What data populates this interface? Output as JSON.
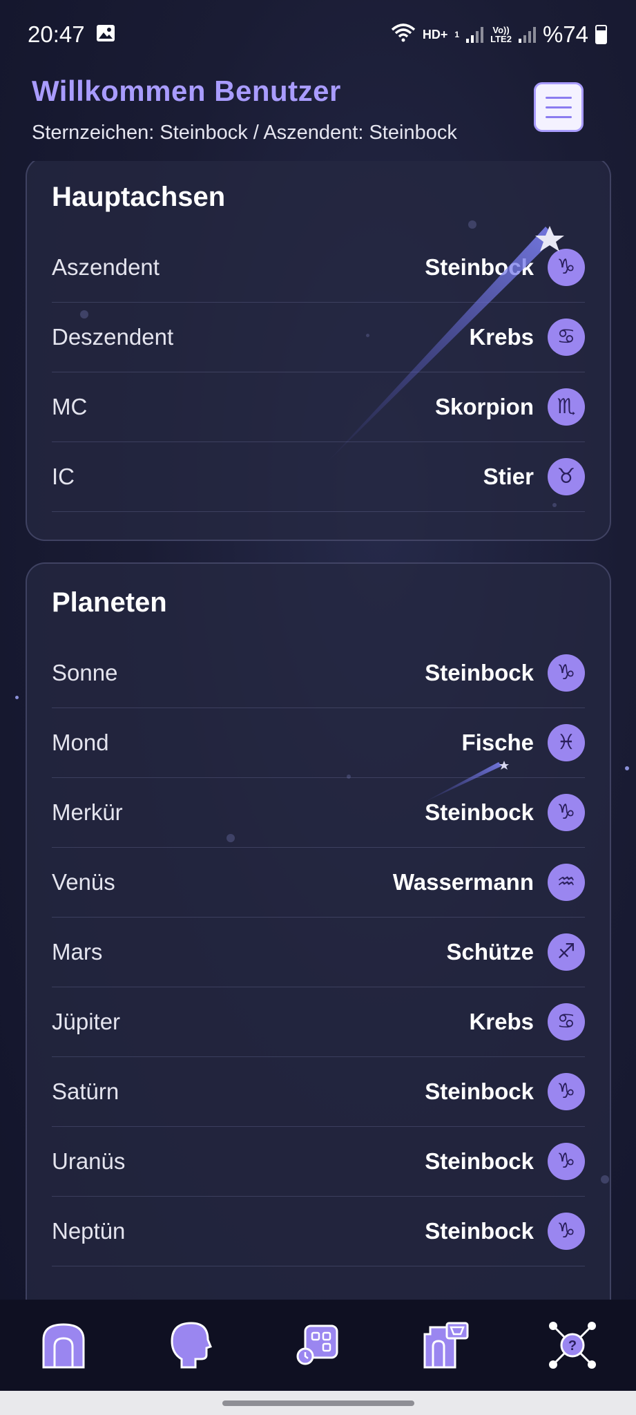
{
  "status_bar": {
    "time": "20:47",
    "network_hd": "HD+",
    "network_sub": "1",
    "volte": "Vo))",
    "lte": "LTE2",
    "battery_text": "%74"
  },
  "header": {
    "title": "Willkommen Benutzer",
    "subtitle": "Sternzeichen: Steinbock / Aszendent: Steinbock"
  },
  "hauptachsen": {
    "title": "Hauptachsen",
    "rows": [
      {
        "label": "Aszendent",
        "value": "Steinbock",
        "icon": "capricorn-icon"
      },
      {
        "label": "Deszendent",
        "value": "Krebs",
        "icon": "cancer-icon"
      },
      {
        "label": "MC",
        "value": "Skorpion",
        "icon": "scorpio-icon"
      },
      {
        "label": "IC",
        "value": "Stier",
        "icon": "taurus-icon"
      }
    ]
  },
  "planeten": {
    "title": "Planeten",
    "rows": [
      {
        "label": "Sonne",
        "value": "Steinbock",
        "icon": "capricorn-icon"
      },
      {
        "label": "Mond",
        "value": "Fische",
        "icon": "pisces-icon"
      },
      {
        "label": "Merkür",
        "value": "Steinbock",
        "icon": "capricorn-icon"
      },
      {
        "label": "Venüs",
        "value": "Wassermann",
        "icon": "aquarius-icon"
      },
      {
        "label": "Mars",
        "value": "Schütze",
        "icon": "sagittarius-icon"
      },
      {
        "label": "Jüpiter",
        "value": "Krebs",
        "icon": "cancer-icon"
      },
      {
        "label": "Satürn",
        "value": "Steinbock",
        "icon": "capricorn-icon"
      },
      {
        "label": "Uranüs",
        "value": "Steinbock",
        "icon": "capricorn-icon"
      },
      {
        "label": "Neptün",
        "value": "Steinbock",
        "icon": "capricorn-icon"
      }
    ]
  },
  "bottom_nav": [
    {
      "name": "home",
      "icon": "home-icon"
    },
    {
      "name": "profile",
      "icon": "head-profile-icon"
    },
    {
      "name": "apps",
      "icon": "apps-grid-icon"
    },
    {
      "name": "shop",
      "icon": "shop-icon"
    },
    {
      "name": "network",
      "icon": "network-help-icon"
    }
  ],
  "colors": {
    "accent": "#a99cff",
    "icon_fill": "#9a86f0",
    "background": "#1a1c34",
    "card": "#262842"
  }
}
